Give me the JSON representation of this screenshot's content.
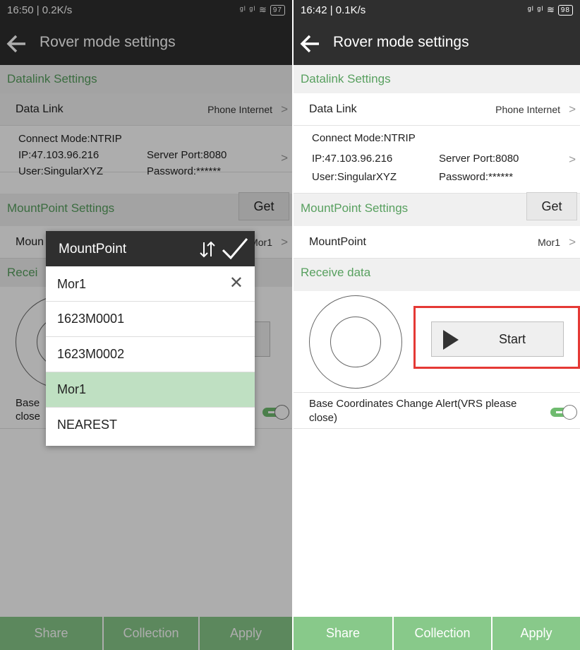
{
  "left": {
    "status": {
      "time": "16:50 | 0.2K/s",
      "icons": "ᵍˡ ᵍˡ ≋",
      "battery": "97"
    },
    "title": "Rover mode settings",
    "datalink_section": "Datalink Settings",
    "data_link": {
      "label": "Data Link",
      "value": "Phone Internet"
    },
    "connection": {
      "mode": "Connect Mode:NTRIP",
      "ip": "IP:47.103.96.216",
      "port": "Server Port:8080",
      "user": "User:SingularXYZ",
      "password": "Password:******"
    },
    "mount_section": "MountPoint Settings",
    "get_button": "Get",
    "mountpoint": {
      "label": "Moun",
      "value": "Mor1"
    },
    "receive_section": "Recei",
    "alert": {
      "line1": "Base",
      "line2": "close"
    },
    "bottom": {
      "share": "Share",
      "collection": "Collection",
      "apply": "Apply"
    },
    "dialog": {
      "title": "MountPoint",
      "search_value": "Mor1",
      "options": [
        {
          "label": "1623M0001",
          "selected": false
        },
        {
          "label": "1623M0002",
          "selected": false
        },
        {
          "label": "Mor1",
          "selected": true
        },
        {
          "label": "NEAREST",
          "selected": false
        }
      ]
    }
  },
  "right": {
    "status": {
      "time": "16:42 | 0.1K/s",
      "icons": "ᵍˡ ᵍˡ ≋",
      "battery": "98"
    },
    "title": "Rover mode settings",
    "datalink_section": "Datalink Settings",
    "data_link": {
      "label": "Data Link",
      "value": "Phone Internet"
    },
    "connection": {
      "mode": "Connect Mode:NTRIP",
      "ip": "IP:47.103.96.216",
      "port": "Server Port:8080",
      "user": "User:SingularXYZ",
      "password": "Password:******"
    },
    "mount_section": "MountPoint Settings",
    "get_button": "Get",
    "mountpoint": {
      "label": "MountPoint",
      "value": "Mor1"
    },
    "receive_section": "Receive data",
    "start_button": "Start",
    "alert": {
      "line1": "Base Coordinates Change Alert(VRS please",
      "line2": "close)"
    },
    "bottom": {
      "share": "Share",
      "collection": "Collection",
      "apply": "Apply"
    }
  },
  "colors": {
    "accent_green": "#58a05f",
    "bottom_bar": "#88c98a",
    "appbar": "#2f2f2f",
    "highlight_red": "#e53935",
    "selected_row": "#bfe0c2"
  }
}
